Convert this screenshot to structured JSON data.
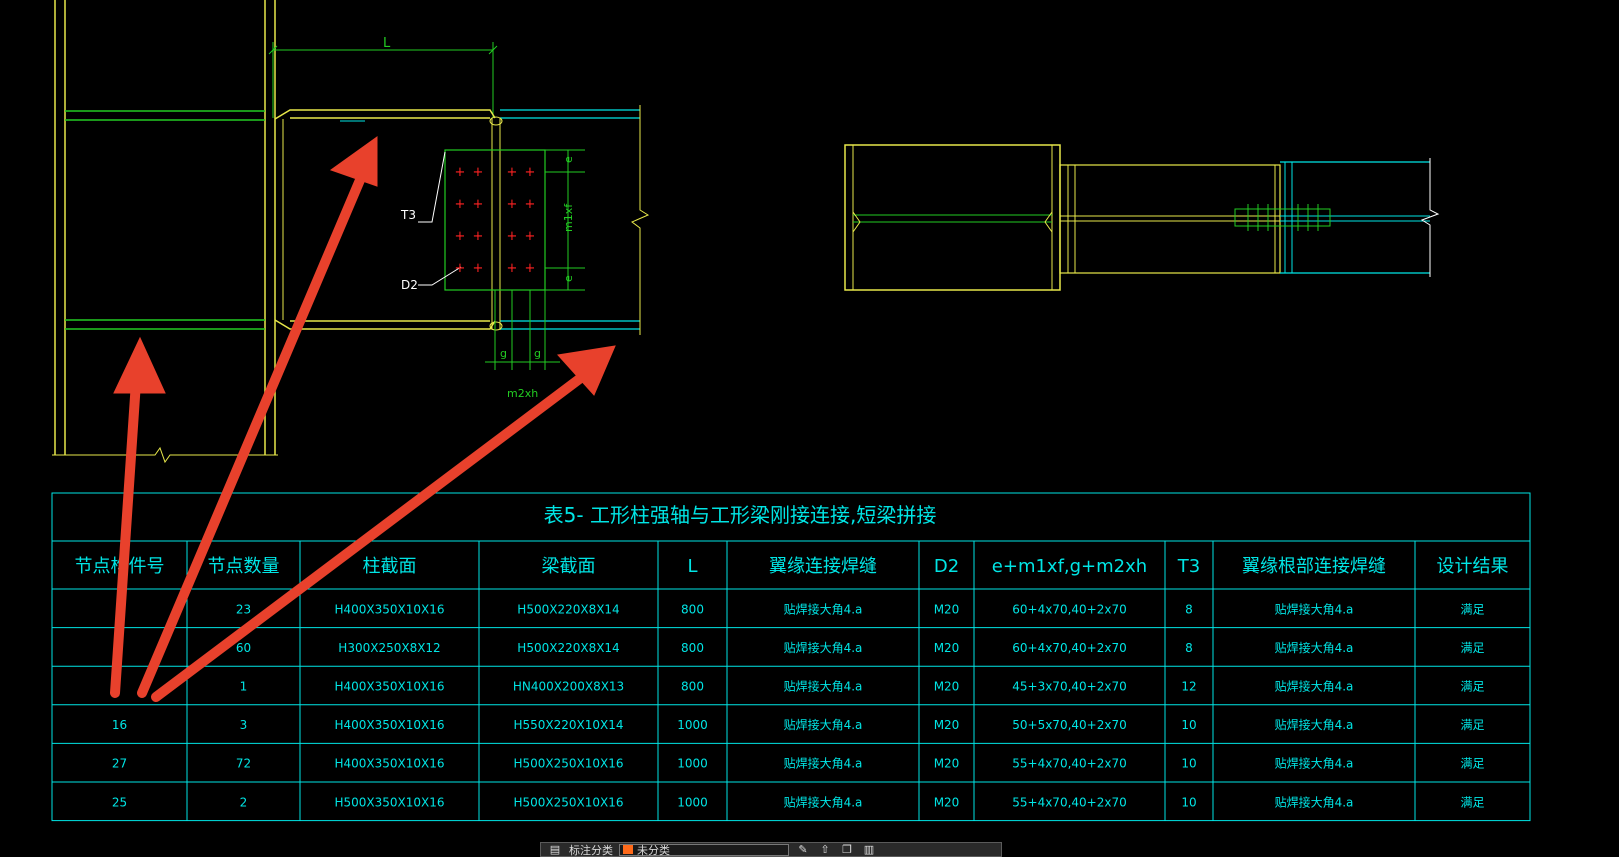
{
  "drawing": {
    "dim_labels": {
      "length": "L",
      "edge_top": "e",
      "edge_bottom": "e",
      "m1": "m1xf",
      "g_left": "g",
      "g_right": "g",
      "m2": "m2xh",
      "t3": "T3",
      "d2": "D2"
    }
  },
  "table": {
    "title": "表5- 工形柱强轴与工形梁刚接连接,短梁拼接",
    "headers": [
      "节点构件号",
      "节点数量",
      "柱截面",
      "梁截面",
      "L",
      "翼缘连接焊缝",
      "D2",
      "e+m1xf,g+m2xh",
      "T3",
      "翼缘根部连接焊缝",
      "设计结果"
    ],
    "rows": [
      [
        "",
        "23",
        "H400X350X10X16",
        "H500X220X8X14",
        "800",
        "贴焊接大角4.a",
        "M20",
        "60+4x70,40+2x70",
        "8",
        "贴焊接大角4.a",
        "满足"
      ],
      [
        "",
        "60",
        "H300X250X8X12",
        "H500X220X8X14",
        "800",
        "贴焊接大角4.a",
        "M20",
        "60+4x70,40+2x70",
        "8",
        "贴焊接大角4.a",
        "满足"
      ],
      [
        "",
        "1",
        "H400X350X10X16",
        "HN400X200X8X13",
        "800",
        "贴焊接大角4.a",
        "M20",
        "45+3x70,40+2x70",
        "12",
        "贴焊接大角4.a",
        "满足"
      ],
      [
        "16",
        "3",
        "H400X350X10X16",
        "H550X220X10X14",
        "1000",
        "贴焊接大角4.a",
        "M20",
        "50+5x70,40+2x70",
        "10",
        "贴焊接大角4.a",
        "满足"
      ],
      [
        "27",
        "72",
        "H400X350X10X16",
        "H500X250X10X16",
        "1000",
        "贴焊接大角4.a",
        "M20",
        "55+4x70,40+2x70",
        "10",
        "贴焊接大角4.a",
        "满足"
      ],
      [
        "25",
        "2",
        "H500X350X10X16",
        "H500X250X10X16",
        "1000",
        "贴焊接大角4.a",
        "M20",
        "55+4x70,40+2x70",
        "10",
        "贴焊接大角4.a",
        "满足"
      ]
    ]
  },
  "toolbar": {
    "label": "标注分类",
    "selected": "未分类"
  },
  "colors": {
    "background": "#000000",
    "cyan": "#00e5e5",
    "green": "#22cc22",
    "yellow": "#e8e84a",
    "red": "#ff2222",
    "arrow": "#e8412c"
  }
}
